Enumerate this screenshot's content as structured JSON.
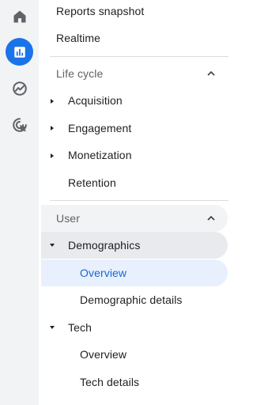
{
  "rail": {
    "items": [
      {
        "icon": "home-icon",
        "active": false
      },
      {
        "icon": "reports-bar-chart-icon",
        "active": true
      },
      {
        "icon": "explore-trend-icon",
        "active": false
      },
      {
        "icon": "advertising-cursor-icon",
        "active": false
      }
    ]
  },
  "nav": {
    "reports_snapshot": "Reports snapshot",
    "realtime": "Realtime",
    "life_cycle": {
      "label": "Life cycle",
      "expanded": true,
      "items": [
        {
          "label": "Acquisition",
          "expandable": true
        },
        {
          "label": "Engagement",
          "expandable": true
        },
        {
          "label": "Monetization",
          "expandable": true
        },
        {
          "label": "Retention",
          "expandable": false
        }
      ]
    },
    "user": {
      "label": "User",
      "expanded": true,
      "demographics": {
        "label": "Demographics",
        "expanded": true,
        "items": [
          {
            "label": "Overview",
            "selected": true
          },
          {
            "label": "Demographic details",
            "selected": false
          }
        ]
      },
      "tech": {
        "label": "Tech",
        "expanded": true,
        "items": [
          {
            "label": "Overview",
            "selected": false
          },
          {
            "label": "Tech details",
            "selected": false
          }
        ]
      }
    }
  },
  "colors": {
    "accent": "#1a73e8",
    "selected_bg": "#e8f0fe",
    "selected_text": "#1967d2",
    "rail_bg": "#f1f3f4"
  }
}
